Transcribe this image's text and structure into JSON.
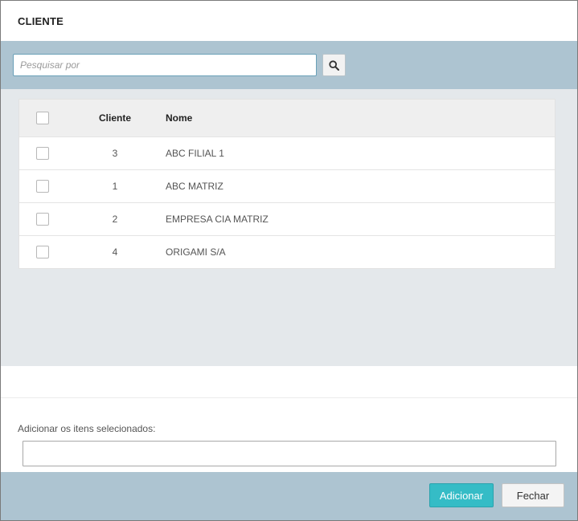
{
  "modal": {
    "title": "CLIENTE"
  },
  "search": {
    "placeholder": "Pesquisar por",
    "value": "",
    "icon": "search-icon"
  },
  "table": {
    "columns": {
      "cliente": "Cliente",
      "nome": "Nome"
    },
    "rows": [
      {
        "cliente": "3",
        "nome": "ABC FILIAL 1"
      },
      {
        "cliente": "1",
        "nome": "ABC MATRIZ"
      },
      {
        "cliente": "2",
        "nome": "EMPRESA CIA MATRIZ"
      },
      {
        "cliente": "4",
        "nome": "ORIGAMI S/A"
      }
    ]
  },
  "selected": {
    "label": "Adicionar os itens selecionados:",
    "value": ""
  },
  "footer": {
    "add_label": "Adicionar",
    "close_label": "Fechar"
  },
  "colors": {
    "accent": "#35bcc6",
    "bar": "#adc4d1",
    "content_bg": "#e4e8eb"
  }
}
